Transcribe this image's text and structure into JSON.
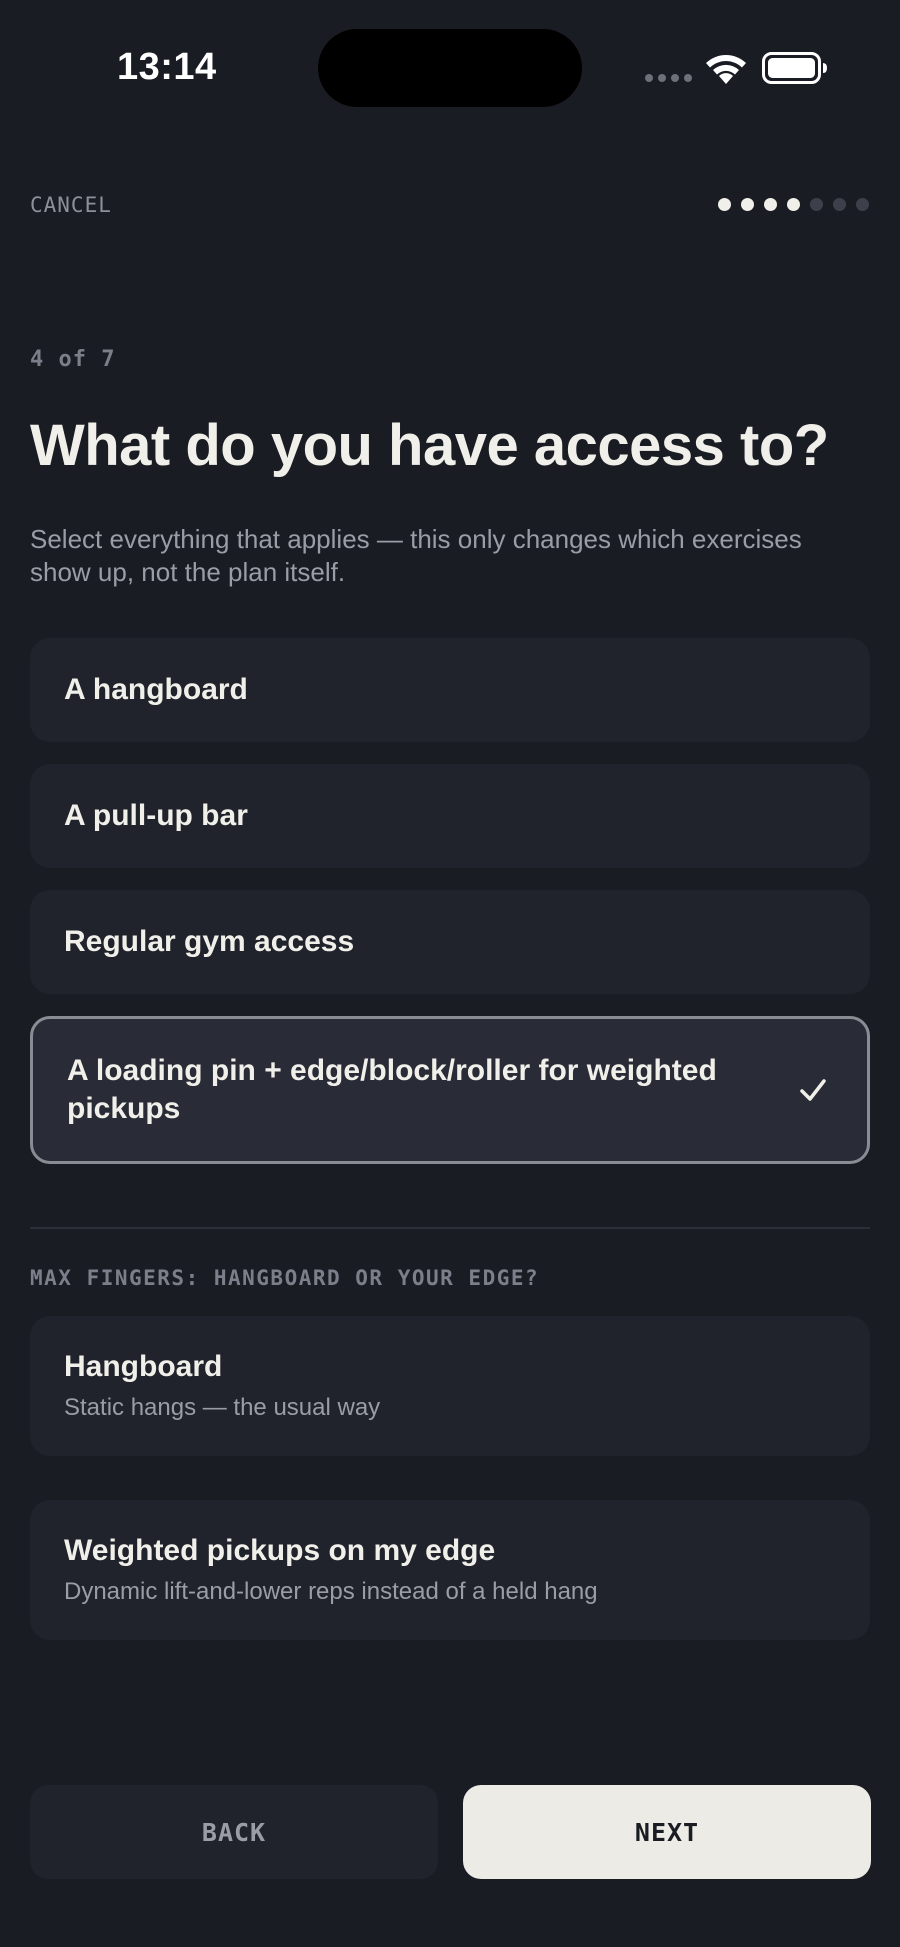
{
  "status_bar": {
    "time": "13:14"
  },
  "nav": {
    "cancel_label": "CANCEL",
    "progress_total": 7,
    "progress_done": 4
  },
  "step_label": "4 of 7",
  "title": "What do you have access to?",
  "subtitle": "Select everything that applies — this only changes which exercises show up, not the plan itself.",
  "options": [
    {
      "label": "A hangboard",
      "selected": false
    },
    {
      "label": "A pull-up bar",
      "selected": false
    },
    {
      "label": "Regular gym access",
      "selected": false
    },
    {
      "label": "A loading pin + edge/block/roller for weighted pickups",
      "selected": true
    }
  ],
  "max_fingers": {
    "section_label": "MAX FINGERS: HANGBOARD OR YOUR EDGE?",
    "choices": [
      {
        "title": "Hangboard",
        "description": "Static hangs — the usual way"
      },
      {
        "title": "Weighted pickups on my edge",
        "description": "Dynamic lift-and-lower reps instead of a held hang"
      }
    ]
  },
  "footer": {
    "back_label": "BACK",
    "next_label": "NEXT"
  },
  "colors": {
    "background": "#1a1c23",
    "card": "#20232b",
    "accent_light": "#edebe6"
  },
  "icons": [
    "wifi-icon",
    "battery-icon",
    "checkmark-icon"
  ]
}
